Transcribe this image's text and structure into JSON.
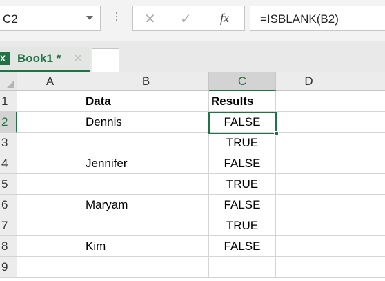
{
  "formula_bar": {
    "name_box": "C2",
    "cancel_glyph": "✕",
    "enter_glyph": "✓",
    "fx_label": "fx",
    "formula": "=ISBLANK(B2)"
  },
  "tabs": {
    "workbook_icon": "excel-icon",
    "workbook_name": "Book1 *",
    "close_glyph": "✕"
  },
  "accent_color": "#217346",
  "columns": [
    "A",
    "B",
    "C",
    "D"
  ],
  "rows": [
    "1",
    "2",
    "3",
    "4",
    "5",
    "6",
    "7",
    "8",
    "9"
  ],
  "cells": {
    "B1": "Data",
    "C1": "Results",
    "B2": "Dennis",
    "C2": "FALSE",
    "B3": "",
    "C3": "TRUE",
    "B4": "Jennifer",
    "C4": "FALSE",
    "B5": "",
    "C5": "TRUE",
    "B6": "Maryam",
    "C6": "FALSE",
    "B7": "",
    "C7": "TRUE",
    "B8": "Kim",
    "C8": "FALSE"
  },
  "active_cell": "C2"
}
